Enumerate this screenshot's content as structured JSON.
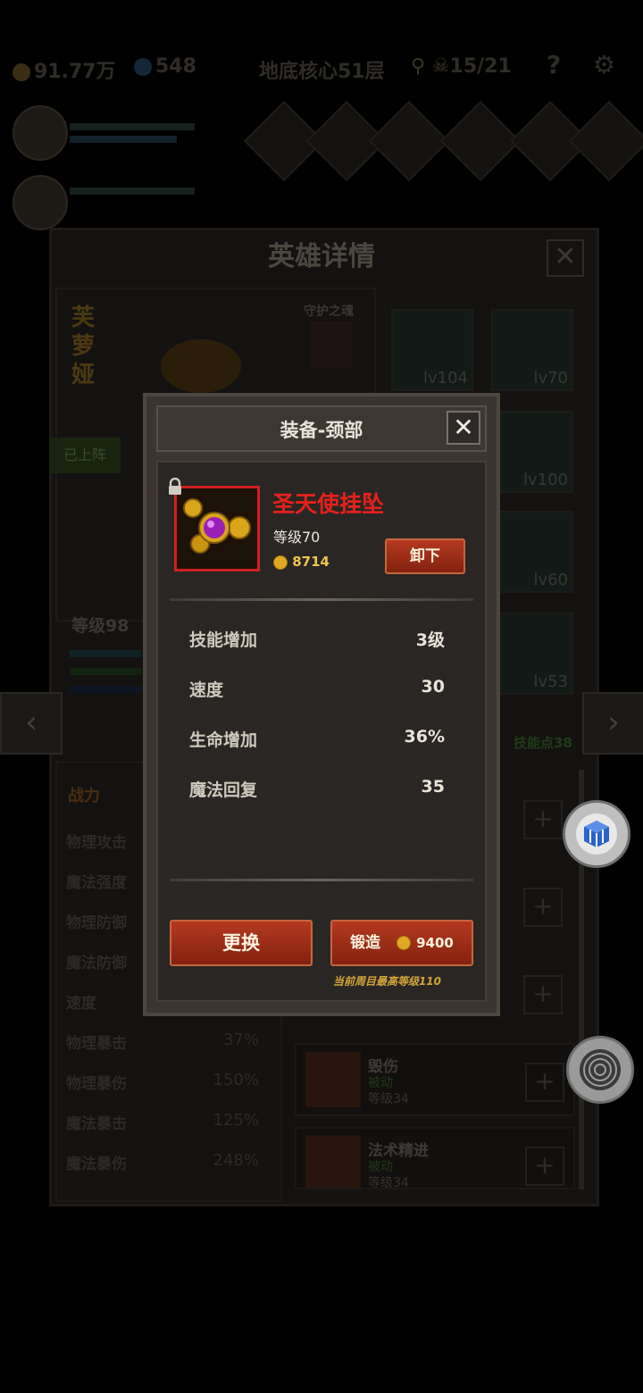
{
  "topbar": {
    "gold": "91.77万",
    "gems": "548",
    "location": "地底核心51层",
    "keys": "15/21",
    "help": "?"
  },
  "background_panel": {
    "title": "英雄详情",
    "close": "✕",
    "hero_name": "芙萝娅",
    "guard_label": "守护之魂",
    "team_status": "已上阵",
    "hero_level": "等级98",
    "skill_points": "技能点38",
    "equipment_levels": [
      "lv104",
      "lv70",
      "lv100",
      "lv60",
      "lv53"
    ],
    "combat_header": "战力",
    "stats": [
      {
        "label": "物理攻击",
        "value": ""
      },
      {
        "label": "魔法强度",
        "value": ""
      },
      {
        "label": "物理防御",
        "value": ""
      },
      {
        "label": "魔法防御",
        "value": ""
      },
      {
        "label": "速度",
        "value": ""
      },
      {
        "label": "物理暴击",
        "value": "37%"
      },
      {
        "label": "物理暴伤",
        "value": "150%"
      },
      {
        "label": "魔法暴击",
        "value": "125%"
      },
      {
        "label": "魔法暴伤",
        "value": "248%"
      }
    ],
    "skills": [
      {
        "name": "毁伤",
        "type": "被动",
        "level": "等级34"
      },
      {
        "name": "法术精进",
        "type": "被动",
        "level": "等级34"
      }
    ]
  },
  "modal": {
    "title": "装备-颈部",
    "close": "✕",
    "item_name": "圣天使挂坠",
    "item_level": "等级70",
    "item_price": "8714",
    "unequip_label": "卸下",
    "stats": [
      {
        "label": "技能增加",
        "value": "3级"
      },
      {
        "label": "速度",
        "value": "30"
      },
      {
        "label": "生命增加",
        "value": "36%"
      },
      {
        "label": "魔法回复",
        "value": "35"
      }
    ],
    "replace_label": "更换",
    "forge_label": "锻造",
    "forge_price": "9400",
    "max_level_note": "当前周目最高等级110"
  },
  "colors": {
    "item_name": "#e5211e",
    "button": "#a3301a",
    "price": "#f0c44d",
    "frame": "#d11f1f"
  },
  "icons": [
    "coin-icon",
    "gem-icon",
    "key-icon",
    "skull-icon",
    "settings-icon",
    "lock-icon",
    "pendant-icon",
    "cube-icon",
    "target-icon"
  ]
}
